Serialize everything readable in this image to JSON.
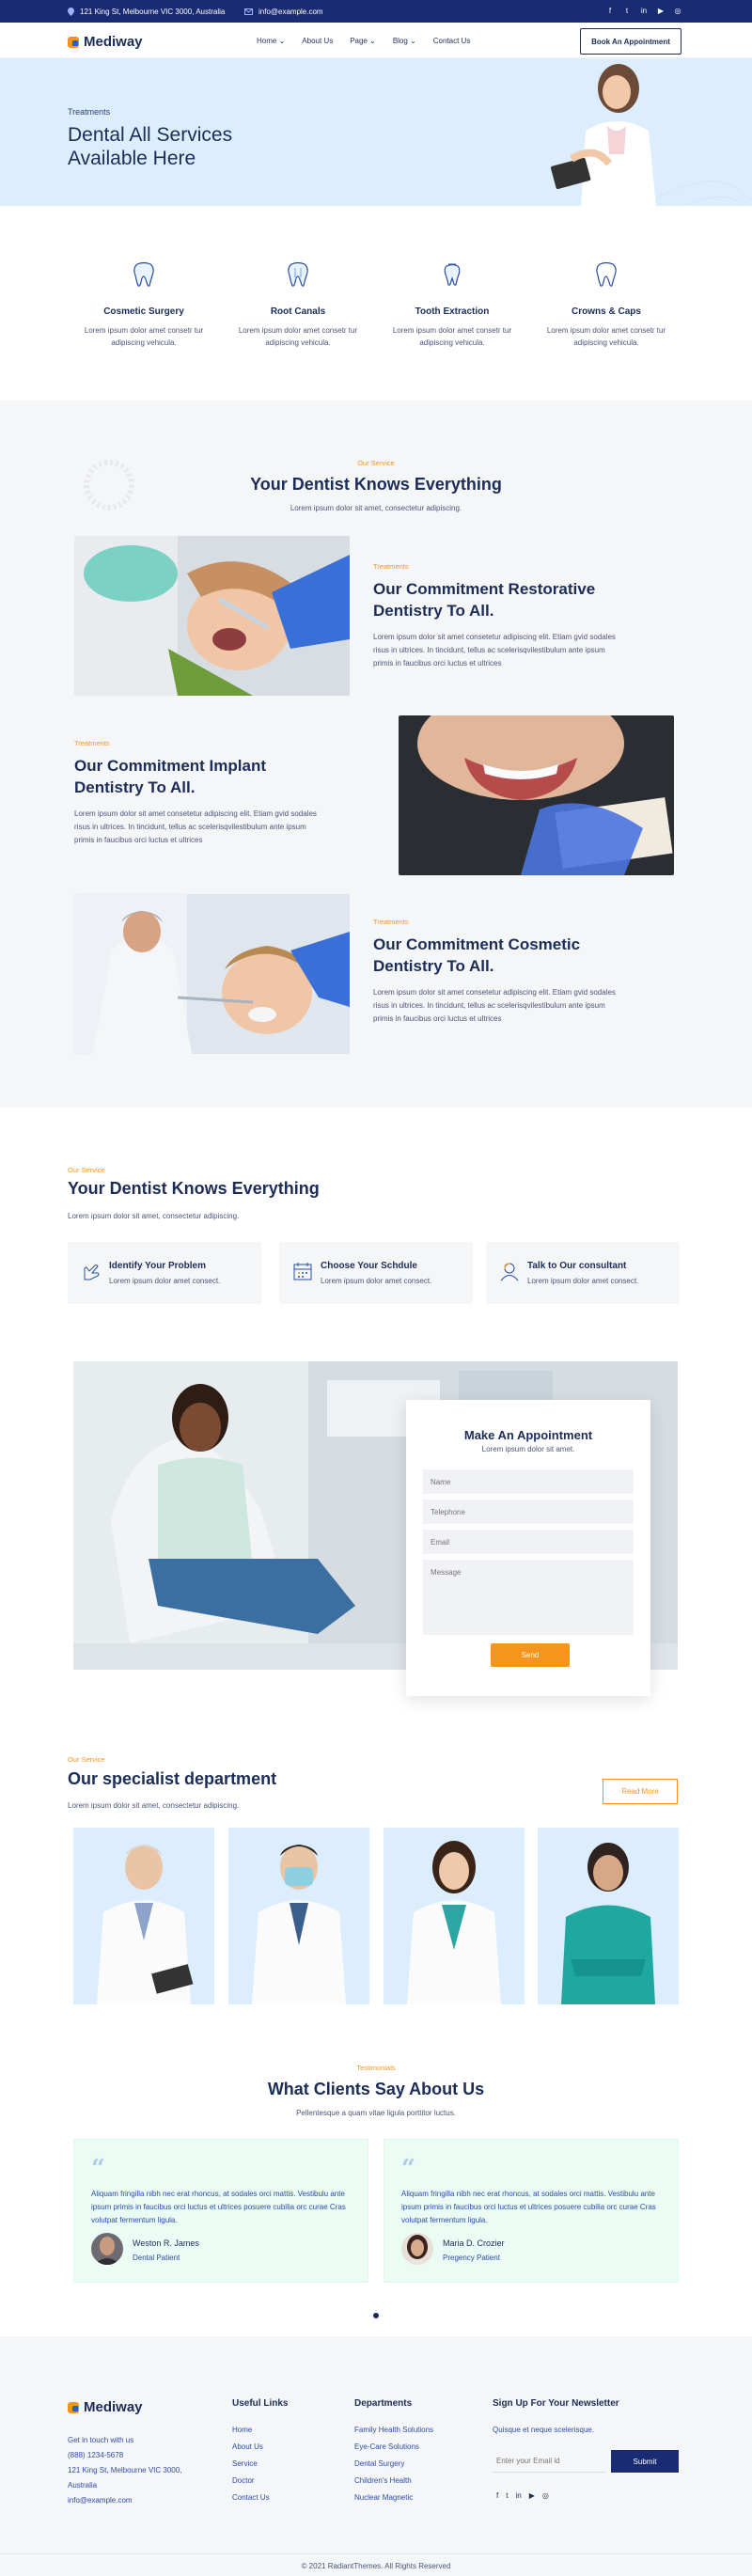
{
  "topbar": {
    "address": "121 King St, Melbourne VIC 3000, Australia",
    "email": "info@example.com",
    "socials": [
      "facebook-icon",
      "twitter-icon",
      "linkedin-icon",
      "youtube-icon",
      "instagram-icon"
    ]
  },
  "brand": {
    "name": "Mediway",
    "accent": "#f7941d",
    "primary": "#192b73"
  },
  "nav": {
    "items": [
      {
        "label": "Home",
        "caret": true
      },
      {
        "label": "About Us",
        "caret": false
      },
      {
        "label": "Page",
        "caret": true
      },
      {
        "label": "Blog",
        "caret": true
      },
      {
        "label": "Contact Us",
        "caret": false
      }
    ],
    "cta": "Book An Appointment"
  },
  "hero": {
    "eyebrow": "Treatments",
    "title": "Dental All Services Available Here"
  },
  "services": [
    {
      "title": "Cosmetic Surgery",
      "text": "Lorem ipsum dolor amet consetr tur adipiscing vehicula."
    },
    {
      "title": "Root Canals",
      "text": "Lorem ipsum dolor amet consetr tur adipiscing vehicula."
    },
    {
      "title": "Tooth Extraction",
      "text": "Lorem ipsum dolor amet consetr tur adipiscing vehicula."
    },
    {
      "title": "Crowns & Caps",
      "text": "Lorem ipsum dolor amet consetr tur adipiscing vehicula."
    }
  ],
  "knows": {
    "eyebrow": "Our Service",
    "title": "Your Dentist Knows Everything",
    "subtitle": "Lorem ipsum dolor sit amet, consectetur adipiscing."
  },
  "blocks": [
    {
      "eyebrow": "Treatments",
      "title": "Our Commitment Restorative Dentistry To All.",
      "text": "Lorem ipsum dolor sit amet consetetur adipiscing elit. Etiam gvid sodales risus in ultrices. In tincidunt, tellus ac scelerisqvilestibulum ante ipsum primis in faucibus orci luctus et ultrices"
    },
    {
      "eyebrow": "Treatments",
      "title": "Our Commitment Implant Dentistry To All.",
      "text": "Lorem ipsum dolor sit amet consetetur adipiscing elit. Etiam gvid sodales risus in ultrices. In tincidunt, tellus ac scelerisqvilestibulum ante ipsum primis in faucibus orci luctus et ultrices"
    },
    {
      "eyebrow": "Treatments",
      "title": "Our Commitment Cosmetic Dentistry To All.",
      "text": "Lorem ipsum dolor sit amet consetetur adipiscing elit. Etiam gvid sodales risus in ultrices. In tincidunt, tellus ac scelerisqvilestibulum ante ipsum primis in faucibus orci luctus et ultrices"
    }
  ],
  "process": {
    "eyebrow": "Our Service",
    "title": "Your Dentist Knows Everything",
    "subtitle": "Lorem ipsum dolor sit amet, consectetur adipiscing.",
    "steps": [
      {
        "title": "Identify Your Problem",
        "text": "Lorem ipsum dolor amet consect."
      },
      {
        "title": "Choose Your Schdule",
        "text": "Lorem ipsum dolor amet consect."
      },
      {
        "title": "Talk to Our consultant",
        "text": "Lorem ipsum dolor amet consect."
      }
    ]
  },
  "appointment": {
    "title": "Make An Appointment",
    "subtitle": "Lorem ipsum dolor sit amet.",
    "name_placeholder": "Name",
    "phone_placeholder": "Telephone",
    "email_placeholder": "Email",
    "message_placeholder": "Message",
    "send": "Send"
  },
  "department": {
    "eyebrow": "Our Service",
    "title": "Our specialist department",
    "subtitle": "Lorem ipsum dolor sit amet, consectetur adipiscing.",
    "readmore": "Read More"
  },
  "testimonials": {
    "eyebrow": "Testimonials",
    "title": "What Clients Say About Us",
    "subtitle": "Pellentesque a quam vitae ligula porttitor luctus.",
    "items": [
      {
        "text": "Aliquam fringilla nibh nec erat rhoncus, at sodales orci mattis. Vestibulu ante ipsum primis in faucibus orci luctus et ultrices posuere cubilia orc curae Cras volutpat fermentum ligula.",
        "name": "Weston R. James",
        "role": "Dental Patient"
      },
      {
        "text": "Aliquam fringilla nibh nec erat rhoncus, at sodales orci mattis. Vestibulu ante ipsum primis in faucibus orci luctus et ultrices posuere cubilia orc curae Cras volutpat fermentum ligula.",
        "name": "Maria D. Crozier",
        "role": "Pregency Patient"
      }
    ]
  },
  "footer": {
    "contact_intro": "Get in touch with us",
    "phone": "(888) 1234-5678",
    "address": "121 King St, Melbourne VIC 3000, Australia",
    "email": "info@example.com",
    "links_title": "Useful Links",
    "links": [
      "Home",
      "About Us",
      "Service",
      "Doctor",
      "Contact Us"
    ],
    "dept_title": "Departments",
    "departments": [
      "Family Health Solutions",
      "Eye-Care Solutions",
      "Dental Surgery",
      "Children's Health",
      "Nuclear Magnetic"
    ],
    "newsletter_title": "Sign Up For Your Newsletter",
    "newsletter_text": "Quisque et neque scelerisque.",
    "newsletter_placeholder": "Enter your Email id",
    "submit": "Submit",
    "copyright": "© 2021 RadiantThemes. All Rights Reserved"
  }
}
